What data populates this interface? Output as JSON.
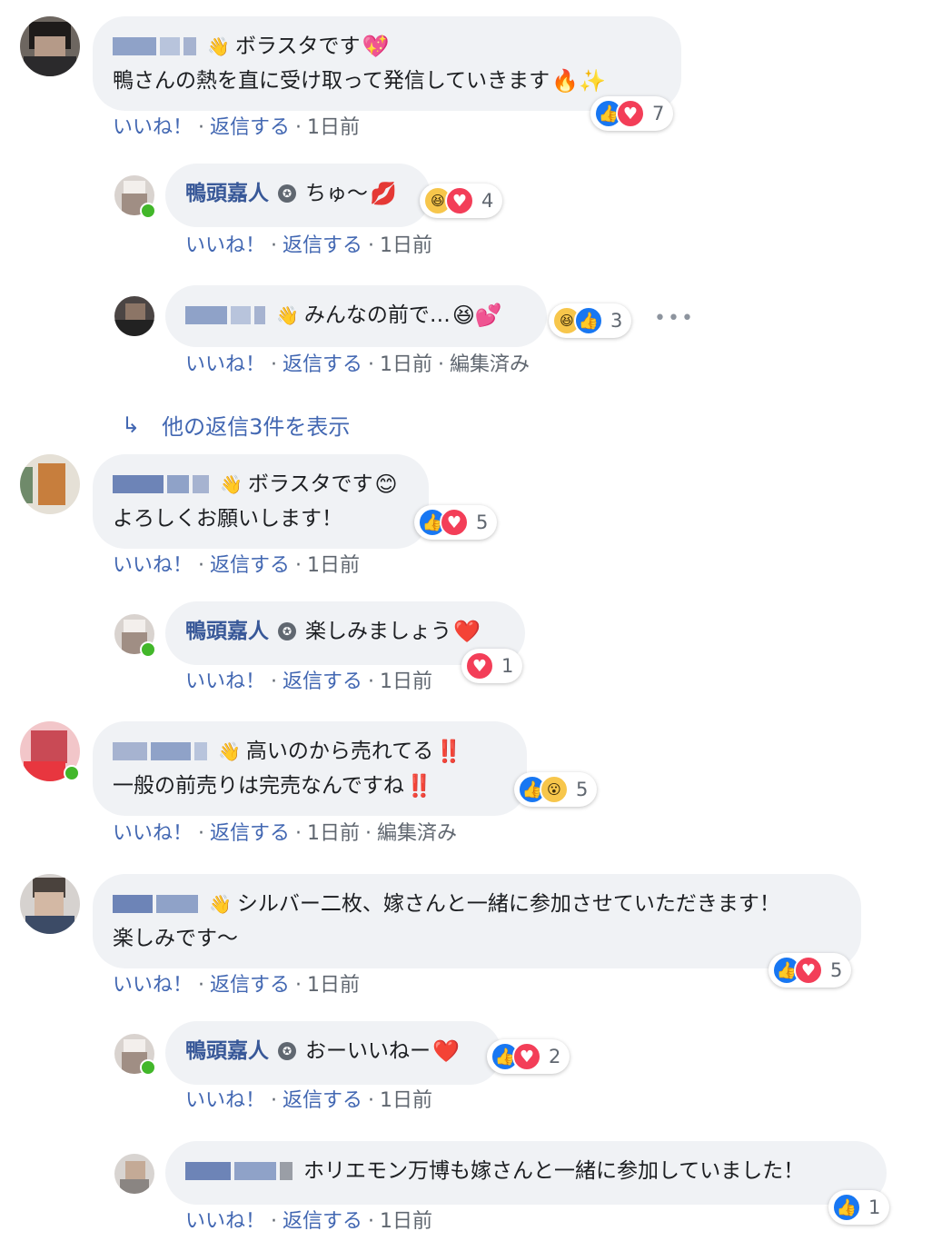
{
  "actions": {
    "like": "いいね！",
    "reply": "返信する",
    "time": "1日前",
    "edited": "編集済み",
    "dot": "·"
  },
  "colors": {
    "link": "#4267b2",
    "name": "#385898",
    "meta": "#606770",
    "bubble": "#f0f2f5",
    "like": "#1877f2",
    "love": "#f33e58"
  },
  "icons": {
    "wave": "waving-hand-icon",
    "badge": "top-fan-badge-icon",
    "more": "more-options-icon",
    "reply_arrow": "reply-arrow-icon"
  },
  "comments": [
    {
      "author": "",
      "badge": "👋",
      "line1": "ボラスタです",
      "line1_emoji": "💖",
      "line2": "鴨さんの熱を直に受け取って発信していきます",
      "line2_emoji": "🔥✨",
      "react_count": "7"
    },
    {
      "author": "鴨頭嘉人",
      "line1": "ちゅ〜",
      "line1_emoji": "💋",
      "react_count": "4"
    },
    {
      "author": "",
      "badge": "👋",
      "line1": "みんなの前で…",
      "line1_emoji": "😆💕",
      "react_count": "3",
      "more": "•••"
    },
    {
      "author": "",
      "badge": "👋",
      "line1": "ボラスタです",
      "line1_emoji": "😊",
      "line2": "よろしくお願いします！",
      "react_count": "5"
    },
    {
      "author": "鴨頭嘉人",
      "line1": "楽しみましょう",
      "line1_emoji": "❤️",
      "react_count": "1"
    },
    {
      "author": "",
      "badge": "👋",
      "line1": "高いのから売れてる",
      "line1_emoji": "‼️",
      "line2": "一般の前売りは完売なんですね",
      "line2_emoji": "‼️",
      "react_count": "5"
    },
    {
      "author": "",
      "badge": "👋",
      "line1": "シルバー二枚、嫁さんと一緒に参加させていただきます！",
      "line2": "楽しみです〜",
      "react_count": "5"
    },
    {
      "author": "鴨頭嘉人",
      "line1": "おーいいねー",
      "line1_emoji": "❤️",
      "react_count": "2"
    },
    {
      "author": "",
      "line1": "ホリエモン万博も嫁さんと一緒に参加していました！",
      "react_count": "1"
    }
  ],
  "more_replies": "他の返信3件を表示"
}
